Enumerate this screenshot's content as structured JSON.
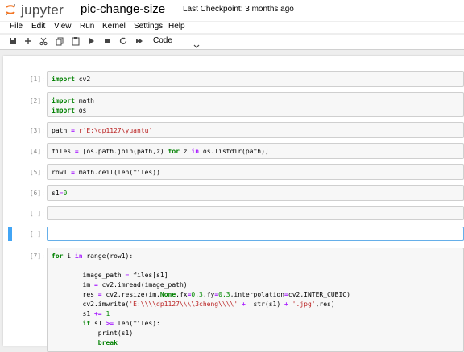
{
  "header": {
    "logo_text": "jupyter",
    "notebook_title": "pic-change-size",
    "checkpoint": "Last Checkpoint: 3 months ago"
  },
  "menu": [
    "File",
    "Edit",
    "View",
    "Run",
    "Kernel",
    "Settings",
    "Help"
  ],
  "toolbar": {
    "buttons": [
      "save-icon",
      "add-cell-icon",
      "cut-icon",
      "copy-icon",
      "paste-icon",
      "run-icon",
      "stop-icon",
      "restart-icon",
      "fast-forward-icon"
    ],
    "cell_type": "Code"
  },
  "cells": [
    {
      "prompt": "[1]:",
      "lines": [
        "import cv2"
      ]
    },
    {
      "prompt": "[2]:",
      "lines": [
        "import math",
        "import os"
      ]
    },
    {
      "prompt": "[3]:",
      "lines": [
        "path = r'E:\\dp1127\\yuantu'"
      ]
    },
    {
      "prompt": "[4]:",
      "lines": [
        "files = [os.path.join(path,z) for z in os.listdir(path)]"
      ]
    },
    {
      "prompt": "[5]:",
      "lines": [
        "row1 = math.ceil(len(files))"
      ]
    },
    {
      "prompt": "[6]:",
      "lines": [
        "s1=0"
      ]
    },
    {
      "prompt": "[ ]:",
      "lines": [
        ""
      ]
    },
    {
      "prompt": "[ ]:",
      "lines": [
        ""
      ]
    },
    {
      "prompt": "[7]:",
      "lines": [
        "for i in range(row1):",
        "",
        "        image_path = files[s1]",
        "        im = cv2.imread(image_path)",
        "        res = cv2.resize(im,None,fx=0.3,fy=0.3,interpolation=cv2.INTER_CUBIC)",
        "        cv2.imwrite('E:\\\\dp1127\\\\3cheng\\\\' +  str(s1) + '.jpg',res)",
        "        s1 += 1",
        "        if s1 >= len(files):",
        "            print(s1)",
        "            break"
      ]
    }
  ]
}
